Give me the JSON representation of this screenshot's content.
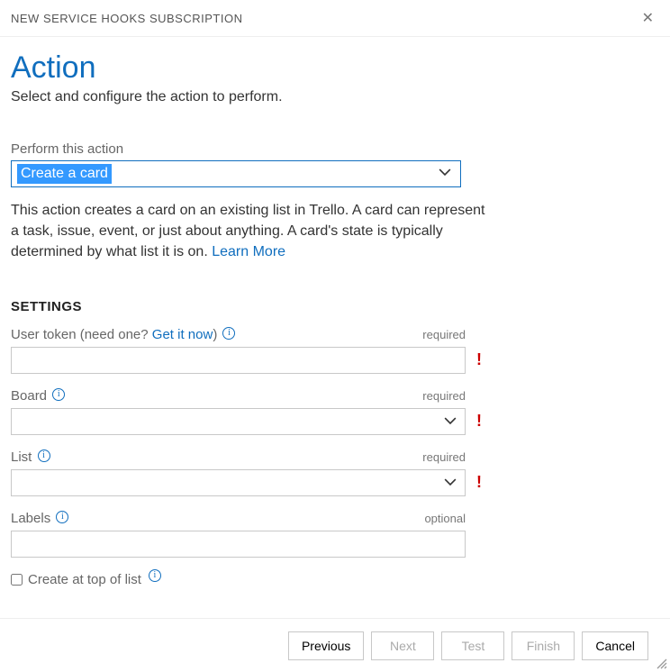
{
  "dialog": {
    "title": "NEW SERVICE HOOKS SUBSCRIPTION"
  },
  "page": {
    "heading": "Action",
    "subheading": "Select and configure the action to perform."
  },
  "perform_action": {
    "label": "Perform this action",
    "selected": "Create a card"
  },
  "action_desc": {
    "text_prefix": "This action creates a card on an existing list in Trello. A card can represent a task, issue, event, or just about anything. A card's state is typically determined by what list it is on. ",
    "learn_more": "Learn More"
  },
  "settings_heading": "SETTINGS",
  "fields": {
    "user_token": {
      "label_prefix": "User token (need one? ",
      "link": "Get it now",
      "label_suffix": ")",
      "req": "required",
      "value": "",
      "error": true
    },
    "board": {
      "label": "Board",
      "req": "required",
      "value": "",
      "error": true
    },
    "list": {
      "label": "List",
      "req": "required",
      "value": "",
      "error": true
    },
    "labels": {
      "label": "Labels",
      "req": "optional",
      "value": "",
      "error": false
    },
    "top_of_list": {
      "label": "Create at top of list",
      "checked": false
    }
  },
  "footer": {
    "previous": "Previous",
    "next": "Next",
    "test": "Test",
    "finish": "Finish",
    "cancel": "Cancel"
  }
}
